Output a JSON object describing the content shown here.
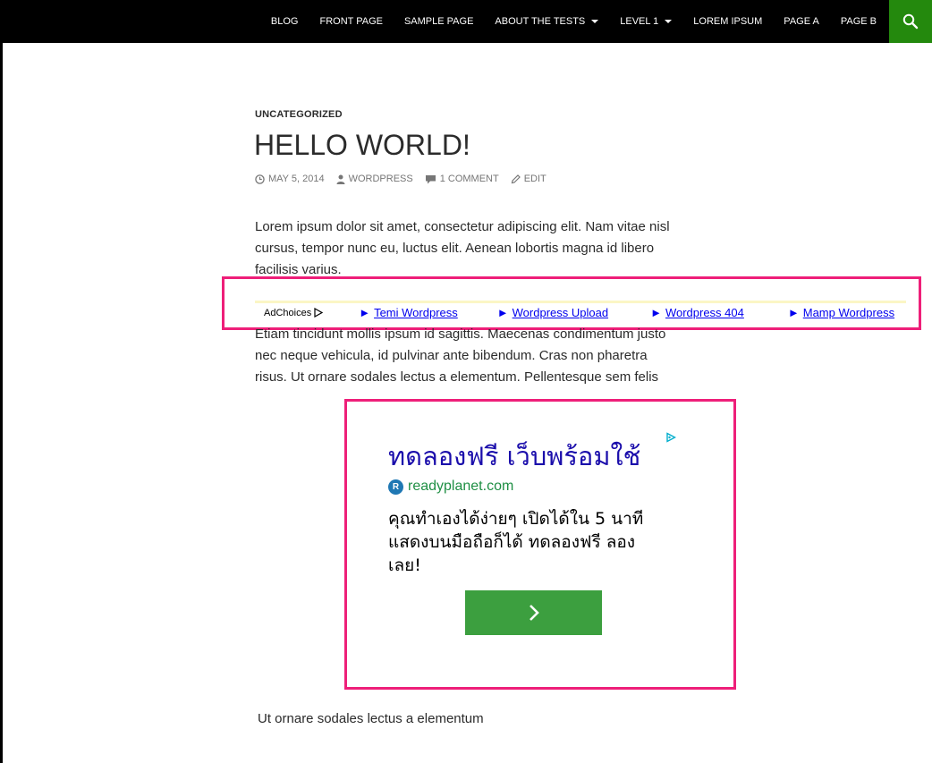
{
  "nav": {
    "items": [
      {
        "label": "BLOG",
        "has_dropdown": false
      },
      {
        "label": "FRONT PAGE",
        "has_dropdown": false
      },
      {
        "label": "SAMPLE PAGE",
        "has_dropdown": false
      },
      {
        "label": "ABOUT THE TESTS",
        "has_dropdown": true
      },
      {
        "label": "LEVEL 1",
        "has_dropdown": true
      },
      {
        "label": "LOREM IPSUM",
        "has_dropdown": false
      },
      {
        "label": "PAGE A",
        "has_dropdown": false
      },
      {
        "label": "PAGE B",
        "has_dropdown": false
      }
    ],
    "search_icon": "search-icon",
    "accent_color": "#24890d"
  },
  "entry": {
    "category": "UNCATEGORIZED",
    "title": "HELLO WORLD!",
    "meta": {
      "date": "MAY 5, 2014",
      "author": "WORDPRESS",
      "comments": "1 COMMENT",
      "edit": "EDIT"
    },
    "paragraph_1": "Lorem ipsum dolor sit amet, consectetur adipiscing elit. Nam vitae  nisl cursus, tempor nunc eu, luctus elit. Aenean lobortis magna id libero facilisis varius.",
    "paragraph_2": "Etiam tincidunt mollis ipsum id sagittis. Maecenas condimentum justo nec neque vehicula, id pulvinar ante bibendum. Cras non pharetra risus. Ut ornare sodales lectus a elementum. Pellentesque sem felis",
    "paragraph_3": "Ut ornare sodales lectus a elementum"
  },
  "ad_links": {
    "adchoices_label": "AdChoices",
    "arrow": "►",
    "links": [
      "Temi Wordpress",
      "Wordpress Upload",
      "Wordpress 404",
      "Mamp Wordpress"
    ],
    "highlight_color": "#ee1f79"
  },
  "display_ad": {
    "headline": "ทดลองฟรี เว็บพร้อมใช้",
    "domain": "readyplanet.com",
    "logo_letter": "R",
    "description": "คุณทำเองได้ง่ายๆ เปิดได้ใน 5 นาที แสดงบนมือถือก็ได้ ทดลองฟรี ลองเลย!",
    "cta_icon": "chevron-right-icon",
    "cta_color": "#3c9f3f"
  }
}
